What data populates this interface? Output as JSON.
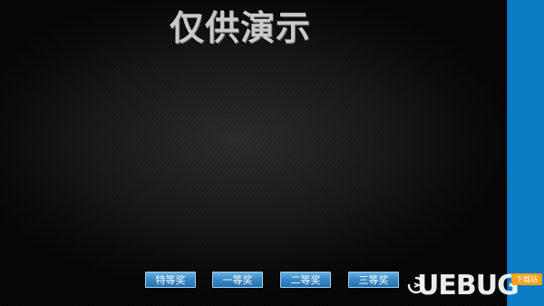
{
  "title": "仅供演示",
  "buttons": {
    "special": "特等奖",
    "first": "一等奖",
    "second": "二等奖",
    "third": "三等奖"
  },
  "watermark": {
    "logo_text": "UEBUG",
    "badge": "下载站"
  },
  "colors": {
    "button": "#3a8ac6",
    "side_panel": "#0a7cc4",
    "title": "#c9c9c9",
    "badge": "#f7a21b"
  }
}
